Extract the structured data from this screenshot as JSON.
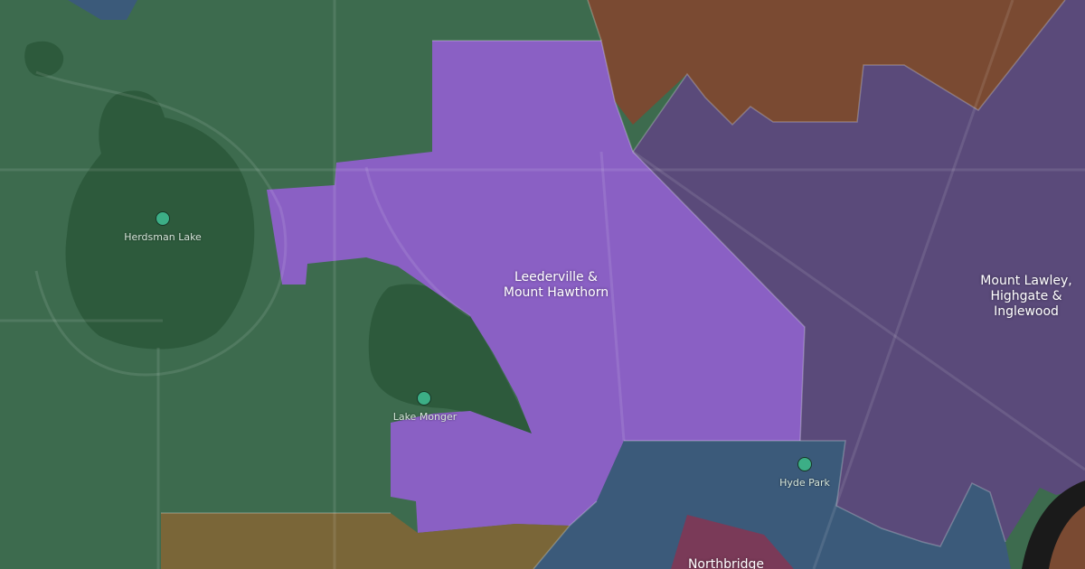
{
  "map": {
    "colors": {
      "background_green": "#3d6b4e",
      "lake": "#2d5a3c",
      "leederville": "#8a60c4",
      "mount_lawley": "#5a4a7a",
      "north_brown": "#7a4a32",
      "hyde_park_blue": "#3b5a7a",
      "south_tan": "#7a6638",
      "northbridge": "#7a3a58",
      "river": "#1a1a1a",
      "marker": "#3cae86"
    },
    "regions": [
      {
        "id": "leederville",
        "label": "Leederville &\nMount Hawthorn"
      },
      {
        "id": "mount-lawley",
        "label": "Mount Lawley,\nHighgate &\nInglewood"
      },
      {
        "id": "northbridge",
        "label": "Northbridge"
      }
    ],
    "pois": [
      {
        "id": "herdsman-lake",
        "label": "Herdsman Lake",
        "icon": "circle-marker"
      },
      {
        "id": "lake-monger",
        "label": "Lake Monger",
        "icon": "circle-marker"
      },
      {
        "id": "hyde-park",
        "label": "Hyde Park",
        "icon": "circle-marker"
      }
    ]
  }
}
